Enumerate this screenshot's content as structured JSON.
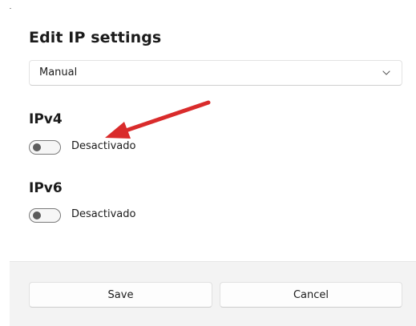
{
  "dialog": {
    "title": "Edit IP settings",
    "mode_select": {
      "value": "Manual",
      "icon": "chevron-down-icon"
    },
    "ipv4": {
      "heading": "IPv4",
      "toggle_state": "off",
      "toggle_label": "Desactivado"
    },
    "ipv6": {
      "heading": "IPv6",
      "toggle_state": "off",
      "toggle_label": "Desactivado"
    },
    "annotation": {
      "icon": "red-arrow-icon",
      "color": "#d92b2b"
    },
    "footer": {
      "save_label": "Save",
      "cancel_label": "Cancel"
    }
  }
}
